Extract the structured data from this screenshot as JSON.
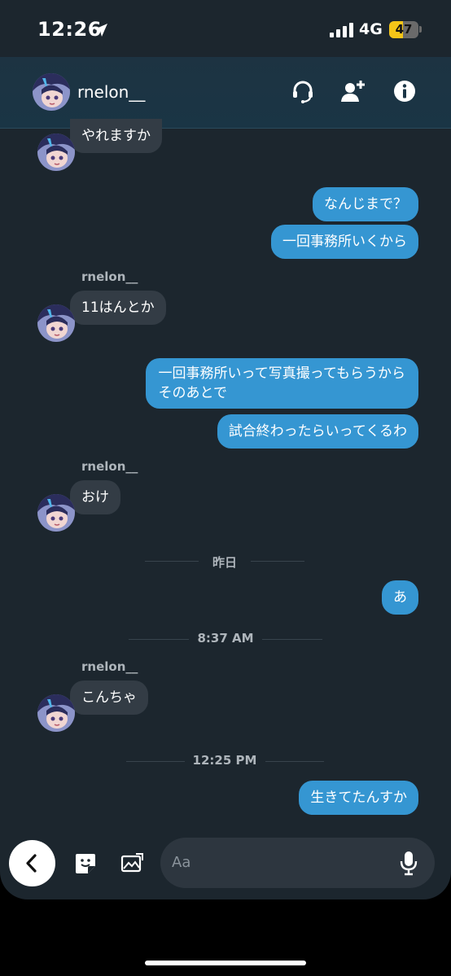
{
  "status_bar": {
    "time": "12:26",
    "network": "4G",
    "battery_level": "47",
    "battery_fraction": 0.47,
    "icons": [
      "location-arrow-icon",
      "signal-bars-icon",
      "battery-icon"
    ]
  },
  "header": {
    "username": "rnelon__",
    "icons": [
      "headset-icon",
      "add-user-icon",
      "info-icon"
    ]
  },
  "messages": [
    {
      "dir": "in",
      "text": "やれますか"
    },
    {
      "dir": "out",
      "text": "なんじまで？"
    },
    {
      "dir": "out",
      "text": "一回事務所いくから"
    },
    {
      "dir": "in",
      "sender": "rnelon__",
      "text": "11はんとか"
    },
    {
      "dir": "out",
      "lines": [
        "一回事務所いって写真撮ってもらうから",
        "そのあとで"
      ]
    },
    {
      "dir": "out",
      "text": "試合終わったらいってくるわ"
    },
    {
      "dir": "in",
      "sender": "rnelon__",
      "text": "おけ"
    },
    {
      "divider": "昨日"
    },
    {
      "dir": "out",
      "text": "あ"
    },
    {
      "divider": "8:37 AM"
    },
    {
      "dir": "in",
      "sender": "rnelon__",
      "text": "こんちゃ"
    },
    {
      "divider": "12:25 PM"
    },
    {
      "dir": "out",
      "text": "生きてたんすか"
    }
  ],
  "composer": {
    "placeholder": "Aa",
    "icons": [
      "back-chevron-icon",
      "sticker-icon",
      "image-icon",
      "microphone-icon"
    ]
  },
  "colors": {
    "background": "#1c262e",
    "outgoing_bubble": "#3596d2",
    "incoming_bubble": "#333c45",
    "battery": "#f5c518"
  }
}
